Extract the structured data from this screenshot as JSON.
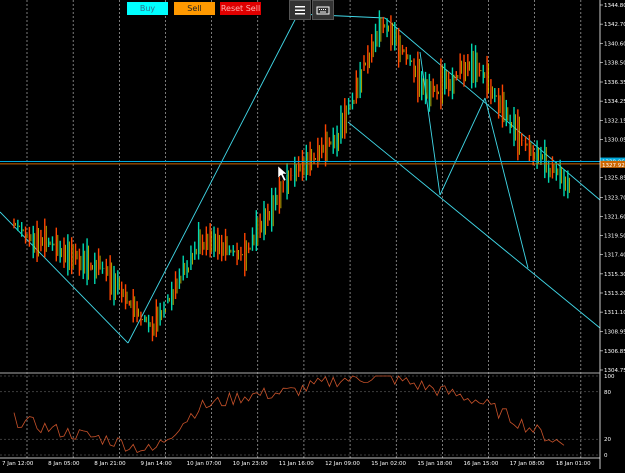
{
  "toolbar": {
    "buy_label": "Buy",
    "sell_label": "Sell",
    "reset_label": "Reset Sell"
  },
  "icons": {
    "menu": "hamburger-menu-icon",
    "keyboard": "keyboard-icon"
  },
  "colors": {
    "background": "#000000",
    "grid": "#ffffff",
    "price_line_cyan": "#00ccee",
    "candles_up": "#00e5a0",
    "candles_down": "#ff3300",
    "trend_lines": "#40d8e8",
    "bid_line": "#00aadd",
    "ask_line": "#cc6600",
    "oscillator": "#c8522a"
  },
  "price_axis": {
    "labels": [
      "1344.80",
      "1342.70",
      "1340.60",
      "1338.50",
      "1336.35",
      "1334.25",
      "1332.15",
      "1330.05",
      "1325.85",
      "1323.70",
      "1321.60",
      "1319.50",
      "1317.40",
      "1315.30",
      "1313.20",
      "1311.10",
      "1308.95",
      "1306.85",
      "1304.75"
    ],
    "current_bid": "1328.06",
    "current_ask": "1327.92"
  },
  "oscillator_axis": {
    "labels": [
      "100",
      "80",
      "20",
      "0"
    ]
  },
  "time_axis": {
    "labels": [
      "7 Jan 12:00",
      "8 Jan 05:00",
      "8 Jan 21:00",
      "9 Jan 14:00",
      "10 Jan 07:00",
      "10 Jan 23:00",
      "11 Jan 16:00",
      "12 Jan 09:00",
      "15 Jan 02:00",
      "15 Jan 18:00",
      "16 Jan 15:00",
      "17 Jan 08:00",
      "18 Jan 01:00"
    ]
  },
  "chart_data": {
    "type": "line",
    "x": [
      "7 Jan 12:00",
      "8 Jan 05:00",
      "8 Jan 21:00",
      "9 Jan 14:00",
      "10 Jan 07:00",
      "10 Jan 23:00",
      "11 Jan 16:00",
      "12 Jan 09:00",
      "15 Jan 02:00",
      "15 Jan 18:00",
      "16 Jan 15:00",
      "17 Jan 08:00",
      "18 Jan 01:00"
    ],
    "series": [
      {
        "values": [
          1320.5,
          1318.0,
          1315.5,
          1309.0,
          1319.0,
          1317.5,
          1326.0,
          1330.5,
          1343.0,
          1335.0,
          1338.5,
          1330.0,
          1325.0
        ]
      }
    ],
    "oscillator": [
      45,
      30,
      20,
      5,
      60,
      75,
      80,
      95,
      100,
      85,
      70,
      40,
      10
    ],
    "ylim": [
      1304.75,
      1344.8
    ],
    "oscillator_levels": [
      100,
      80,
      20,
      0
    ],
    "grid": true
  }
}
